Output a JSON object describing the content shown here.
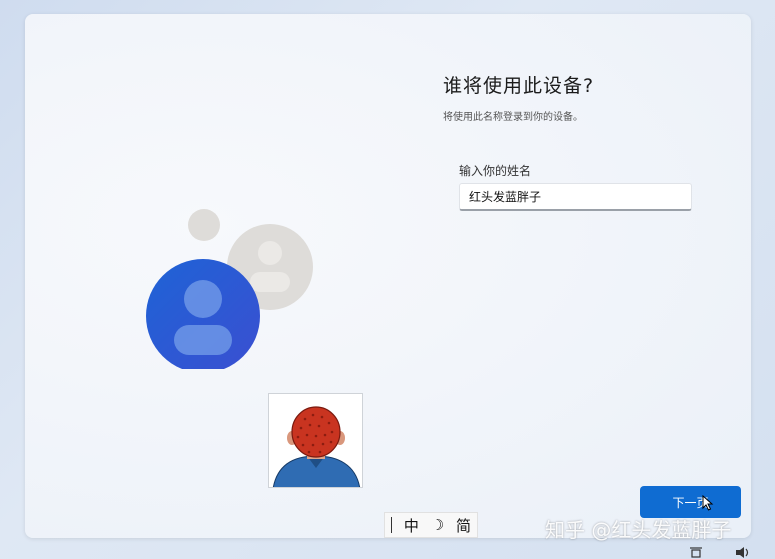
{
  "header": {
    "title": "谁将使用此设备?",
    "subtitle": "将使用此名称登录到你的设备。"
  },
  "form": {
    "name_label": "输入你的姓名",
    "name_value": "红头发蓝胖子"
  },
  "footer": {
    "next_label": "下一页"
  },
  "ime": {
    "mode_char": "中",
    "halfwidth_char": "☽",
    "script_char": "简"
  },
  "watermark": "知乎 @红头发蓝胖子",
  "colors": {
    "accent": "#0f6cd2",
    "primary_avatar": "#1e63d6",
    "secondary_avatar": "#dedcd9"
  },
  "icons": [
    "user-icon",
    "user-icon",
    "mouse-cursor-icon",
    "network-icon",
    "volume-icon"
  ]
}
